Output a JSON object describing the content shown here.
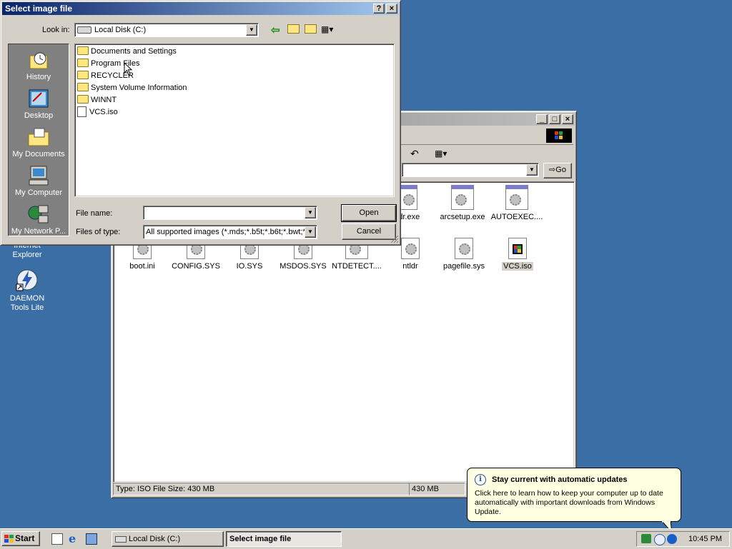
{
  "desktop": {
    "icons": [
      {
        "label": "Internet Explorer"
      },
      {
        "label": "DAEMON Tools Lite"
      }
    ]
  },
  "explorer": {
    "address_value": "",
    "go_label": "Go",
    "files_row1": [
      {
        "label": "ldr.exe"
      },
      {
        "label": "arcsetup.exe"
      },
      {
        "label": "AUTOEXEC...."
      }
    ],
    "files_row2": [
      {
        "label": "boot.ini"
      },
      {
        "label": "CONFIG.SYS"
      },
      {
        "label": "IO.SYS"
      },
      {
        "label": "MSDOS.SYS"
      },
      {
        "label": "NTDETECT...."
      },
      {
        "label": "ntldr"
      },
      {
        "label": "pagefile.sys"
      },
      {
        "label": "VCS.iso"
      }
    ],
    "status_left": "Type: ISO File Size: 430 MB",
    "status_size": "430 MB"
  },
  "dialog": {
    "title": "Select image file",
    "look_in_label": "Look in:",
    "look_in_value": "Local Disk (C:)",
    "places": [
      {
        "label": "History"
      },
      {
        "label": "Desktop"
      },
      {
        "label": "My Documents"
      },
      {
        "label": "My Computer"
      },
      {
        "label": "My Network P..."
      }
    ],
    "items": [
      {
        "label": "Documents and Settings",
        "type": "folder"
      },
      {
        "label": "Program Files",
        "type": "folder"
      },
      {
        "label": "RECYCLER",
        "type": "folder"
      },
      {
        "label": "System Volume Information",
        "type": "folder"
      },
      {
        "label": "WINNT",
        "type": "folder"
      },
      {
        "label": "VCS.iso",
        "type": "file"
      }
    ],
    "file_name_label": "File name:",
    "file_name_value": "",
    "files_of_type_label": "Files of type:",
    "files_of_type_value": "All supported images (*.mds;*.b5t;*.b6t;*.bwt;*.c",
    "open_label": "Open",
    "cancel_label": "Cancel"
  },
  "balloon": {
    "title": "Stay current with automatic updates",
    "body": "Click here to learn how to keep your computer up to date automatically with important downloads from Windows Update."
  },
  "taskbar": {
    "start_label": "Start",
    "tasks": [
      {
        "label": "Local Disk (C:)"
      },
      {
        "label": "Select image file"
      }
    ],
    "clock": "10:45 PM"
  }
}
